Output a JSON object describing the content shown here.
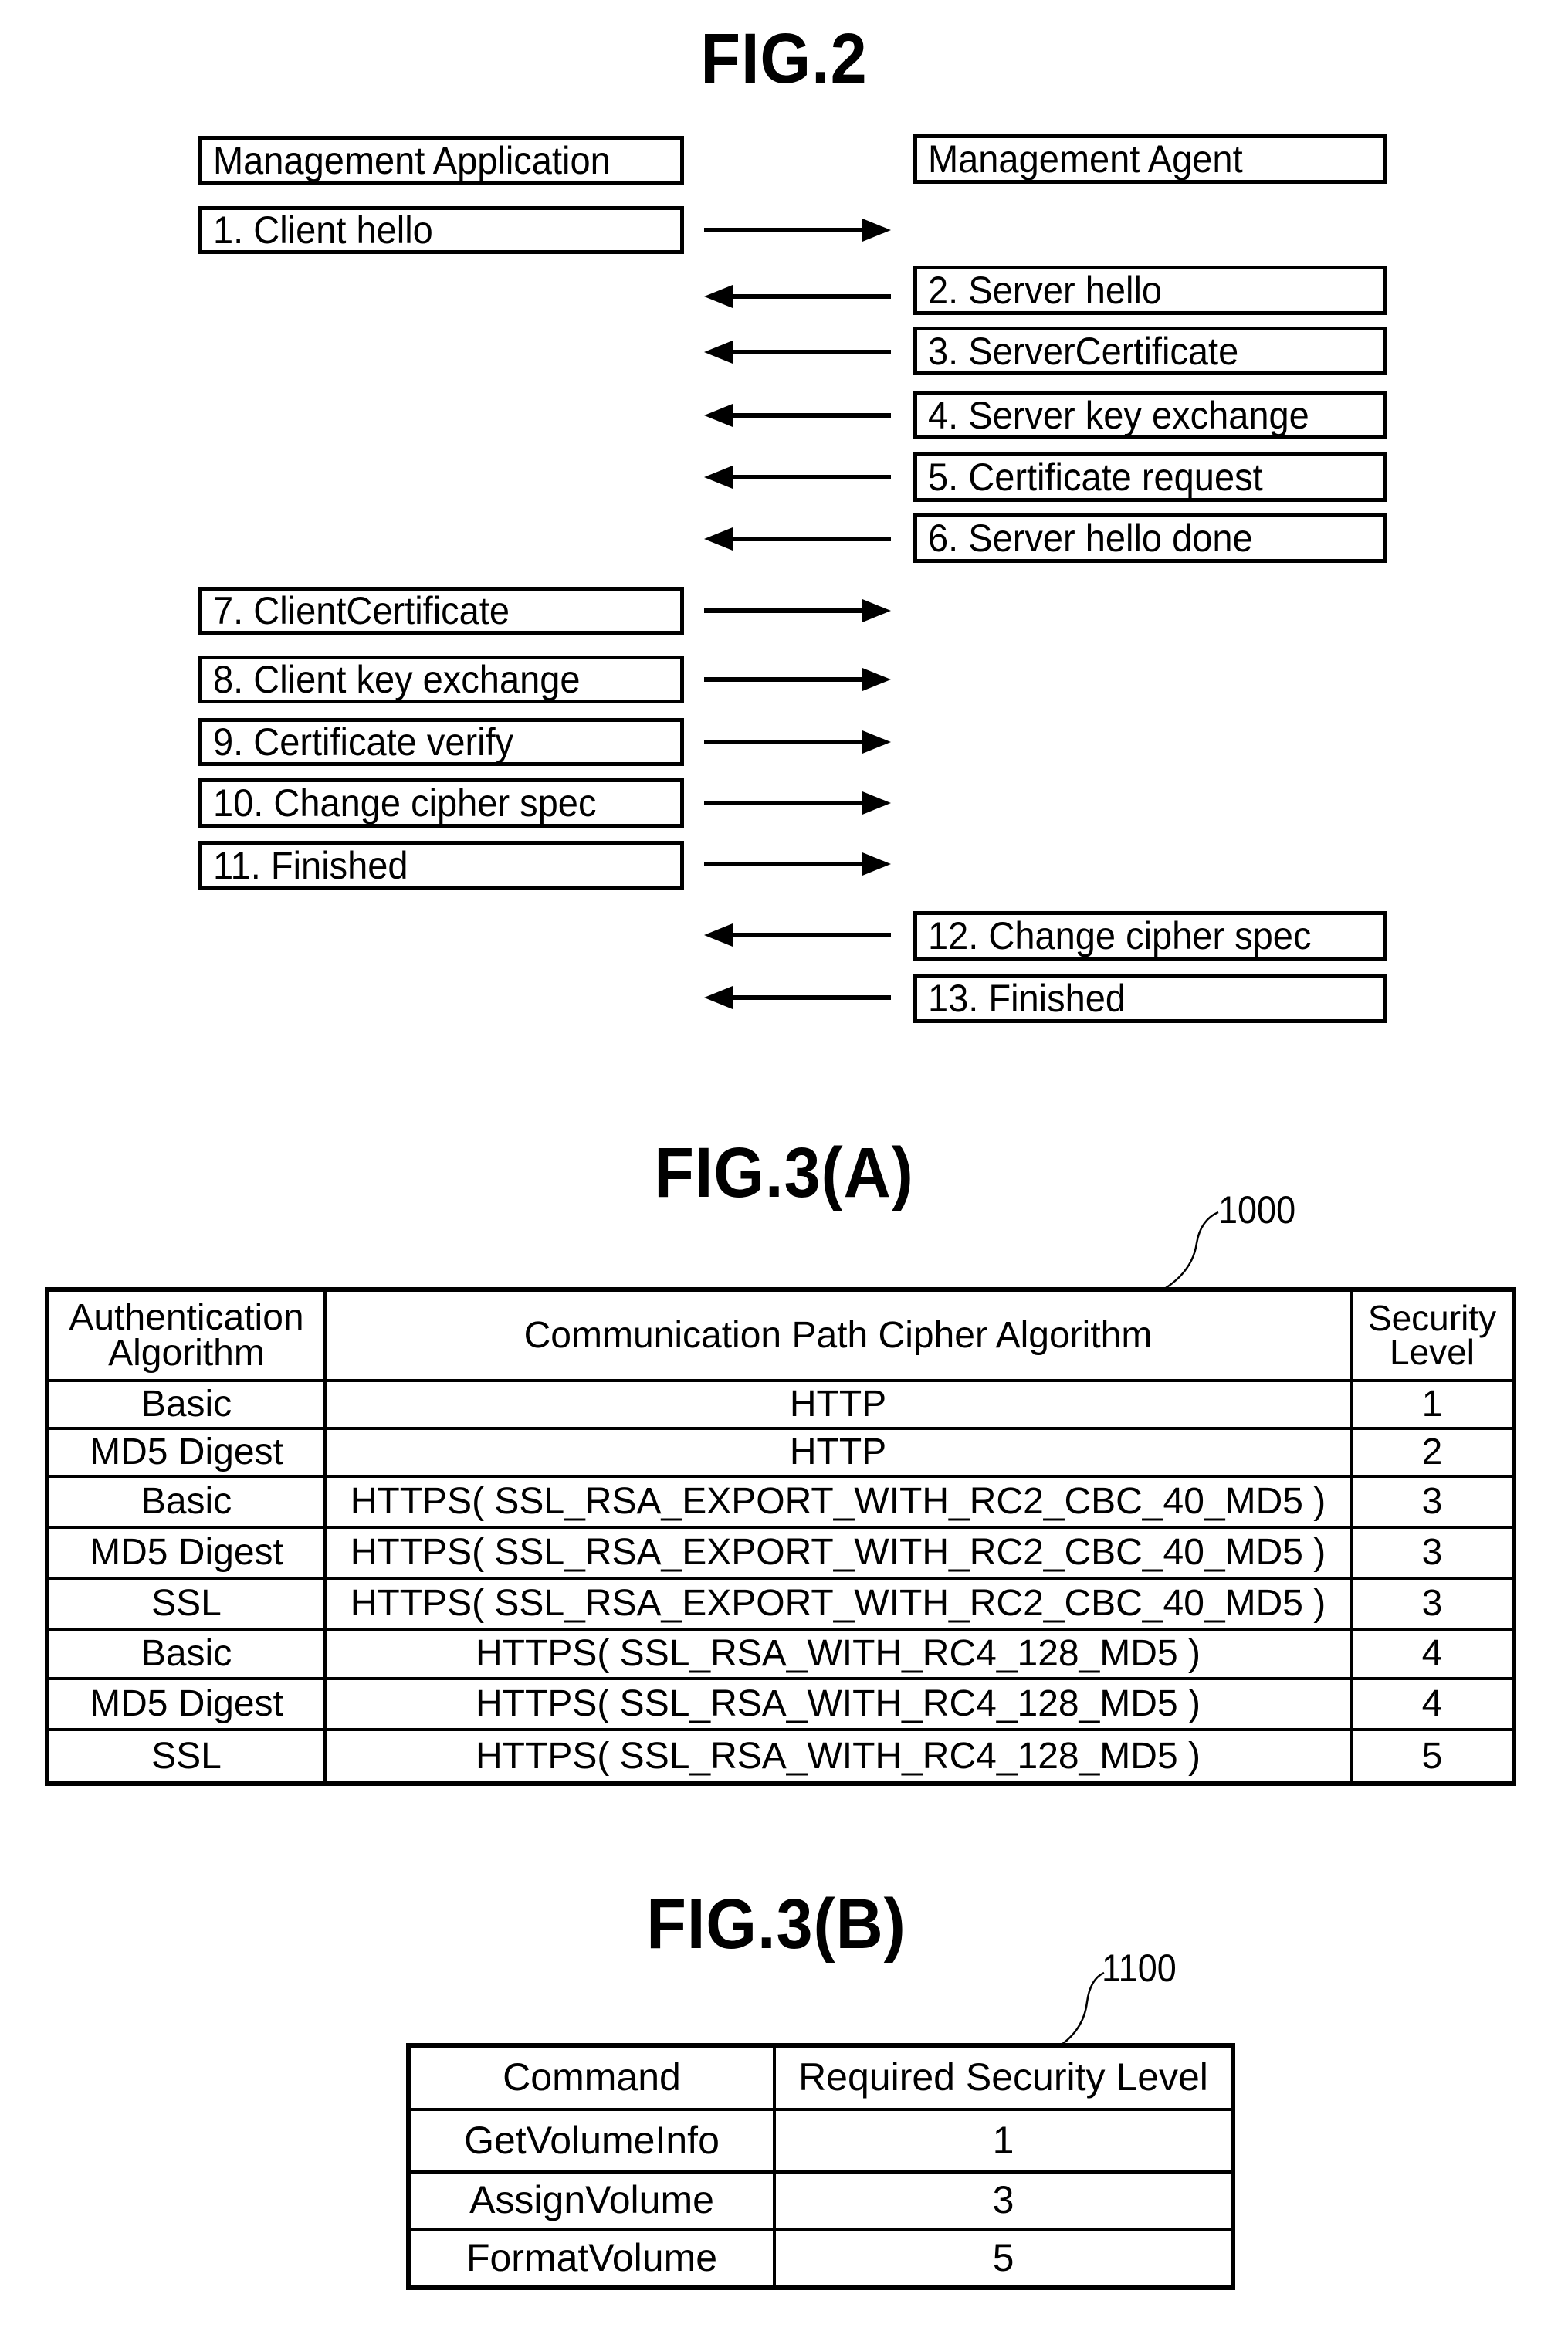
{
  "fig2": {
    "title": "FIG.2",
    "left_header": "Management Application",
    "right_header": "Management Agent",
    "messages": [
      {
        "label": "1. Client hello",
        "side": "left",
        "direction": "right"
      },
      {
        "label": "2. Server hello",
        "side": "right",
        "direction": "left"
      },
      {
        "label": "3. ServerCertificate",
        "side": "right",
        "direction": "left"
      },
      {
        "label": "4. Server key exchange",
        "side": "right",
        "direction": "left"
      },
      {
        "label": "5. Certificate request",
        "side": "right",
        "direction": "left"
      },
      {
        "label": "6. Server hello done",
        "side": "right",
        "direction": "left"
      },
      {
        "label": "7. ClientCertificate",
        "side": "left",
        "direction": "right"
      },
      {
        "label": "8. Client key exchange",
        "side": "left",
        "direction": "right"
      },
      {
        "label": "9. Certificate verify",
        "side": "left",
        "direction": "right"
      },
      {
        "label": "10. Change cipher spec",
        "side": "left",
        "direction": "right"
      },
      {
        "label": "11. Finished",
        "side": "left",
        "direction": "right"
      },
      {
        "label": "12. Change cipher spec",
        "side": "right",
        "direction": "left"
      },
      {
        "label": "13. Finished",
        "side": "right",
        "direction": "left"
      }
    ]
  },
  "fig3a": {
    "title": "FIG.3(A)",
    "ref": "1000",
    "headers": {
      "auth_line1": "Authentication",
      "auth_line2": "Algorithm",
      "cipher": "Communication Path Cipher Algorithm",
      "sec_line1": "Security",
      "sec_line2": "Level"
    },
    "rows": [
      {
        "auth": "Basic",
        "cipher": "HTTP",
        "level": "1"
      },
      {
        "auth": "MD5 Digest",
        "cipher": "HTTP",
        "level": "2"
      },
      {
        "auth": "Basic",
        "cipher": "HTTPS( SSL_RSA_EXPORT_WITH_RC2_CBC_40_MD5 )",
        "level": "3"
      },
      {
        "auth": "MD5 Digest",
        "cipher": "HTTPS( SSL_RSA_EXPORT_WITH_RC2_CBC_40_MD5 )",
        "level": "3"
      },
      {
        "auth": "SSL",
        "cipher": "HTTPS( SSL_RSA_EXPORT_WITH_RC2_CBC_40_MD5 )",
        "level": "3"
      },
      {
        "auth": "Basic",
        "cipher": "HTTPS( SSL_RSA_WITH_RC4_128_MD5 )",
        "level": "4"
      },
      {
        "auth": "MD5 Digest",
        "cipher": "HTTPS( SSL_RSA_WITH_RC4_128_MD5 )",
        "level": "4"
      },
      {
        "auth": "SSL",
        "cipher": "HTTPS( SSL_RSA_WITH_RC4_128_MD5 )",
        "level": "5"
      }
    ]
  },
  "fig3b": {
    "title": "FIG.3(B)",
    "ref": "1100",
    "headers": {
      "command": "Command",
      "required": "Required Security Level"
    },
    "rows": [
      {
        "command": "GetVolumeInfo",
        "level": "1"
      },
      {
        "command": "AssignVolume",
        "level": "3"
      },
      {
        "command": "FormatVolume",
        "level": "5"
      }
    ]
  }
}
